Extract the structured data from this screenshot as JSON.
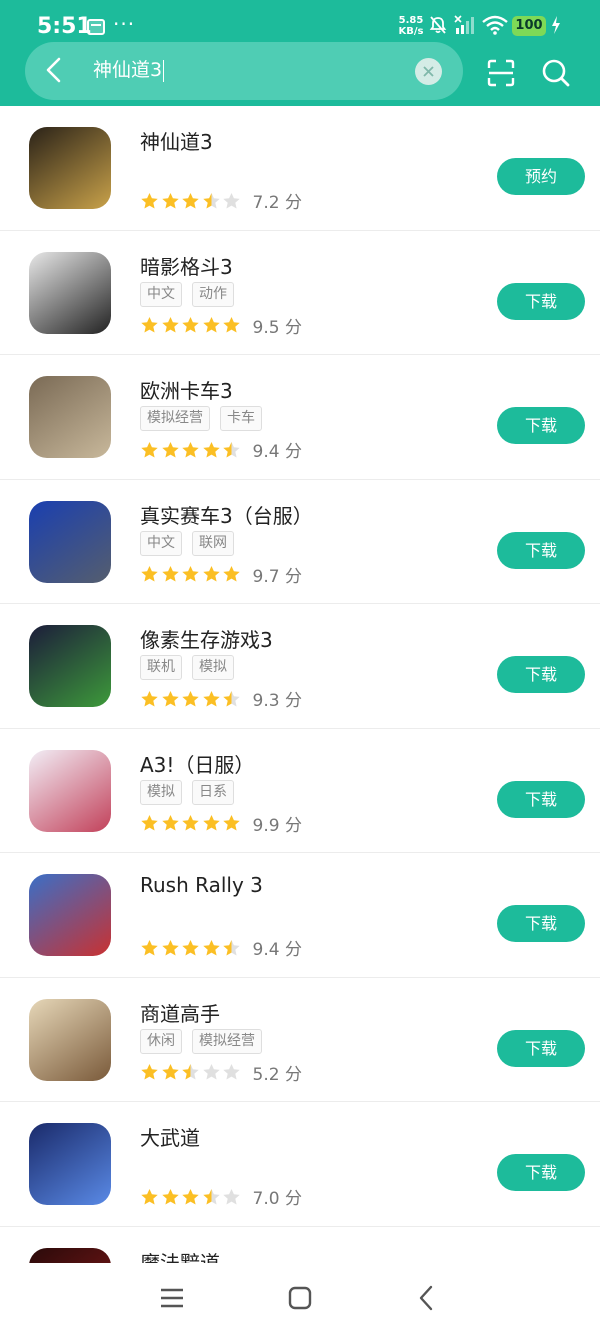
{
  "status_bar": {
    "time": "5:51",
    "more": "···",
    "net_speed_value": "5.85",
    "net_speed_unit": "KB/s",
    "battery": "100"
  },
  "search": {
    "query": "神仙道3"
  },
  "apps": [
    {
      "name": "神仙道3",
      "tags": [],
      "rating": 3.5,
      "score": "7.2 分",
      "button": "预约",
      "icon_colors": [
        "#2a2218",
        "#c9a24a"
      ],
      "icon": "dark-fantasy-creature"
    },
    {
      "name": "暗影格斗3",
      "tags": [
        "中文",
        "动作"
      ],
      "rating": 5,
      "score": "9.5 分",
      "button": "下载",
      "icon_colors": [
        "#e8e8e8",
        "#222222"
      ],
      "icon": "shadow-ninja"
    },
    {
      "name": "欧洲卡车3",
      "tags": [
        "模拟经营",
        "卡车"
      ],
      "rating": 4.5,
      "score": "9.4 分",
      "button": "下载",
      "icon_colors": [
        "#7a6a55",
        "#c8b89b"
      ],
      "icon": "truck"
    },
    {
      "name": "真实赛车3（台服）",
      "tags": [
        "中文",
        "联网"
      ],
      "rating": 5,
      "score": "9.7 分",
      "button": "下载",
      "icon_colors": [
        "#1a3fb0",
        "#555e6e"
      ],
      "icon": "racing-car"
    },
    {
      "name": "像素生存游戏3",
      "tags": [
        "联机",
        "模拟"
      ],
      "rating": 4.5,
      "score": "9.3 分",
      "button": "下载",
      "icon_colors": [
        "#1c1c3a",
        "#3d9a3a"
      ],
      "icon": "pixel-survival"
    },
    {
      "name": "A3!（日服）",
      "tags": [
        "模拟",
        "日系"
      ],
      "rating": 5,
      "score": "9.9 分",
      "button": "下载",
      "icon_colors": [
        "#f2eef6",
        "#c2415a"
      ],
      "icon": "anime-boy"
    },
    {
      "name": "Rush Rally 3",
      "tags": [],
      "rating": 4.5,
      "score": "9.4 分",
      "button": "下载",
      "icon_colors": [
        "#3a6fc7",
        "#c93131"
      ],
      "icon": "rally-car"
    },
    {
      "name": "商道高手",
      "tags": [
        "休闲",
        "模拟经营"
      ],
      "rating": 2.5,
      "score": "5.2 分",
      "button": "下载",
      "icon_colors": [
        "#e6d7b8",
        "#7a5a3a"
      ],
      "icon": "merchant"
    },
    {
      "name": "大武道",
      "tags": [],
      "rating": 3.5,
      "score": "7.0 分",
      "button": "下载",
      "icon_colors": [
        "#1a2a6a",
        "#5a8ae6"
      ],
      "icon": "warrior"
    },
    {
      "name": "魔法黯道",
      "tags": [],
      "rating": 0,
      "score": "",
      "button": "",
      "icon_colors": [
        "#2a0a0a",
        "#8a1a1a"
      ],
      "icon": "dark-magic"
    }
  ],
  "colors": {
    "accent": "#1dbb9b",
    "star": "#fbbf24",
    "star_empty": "#e0e0e0"
  }
}
